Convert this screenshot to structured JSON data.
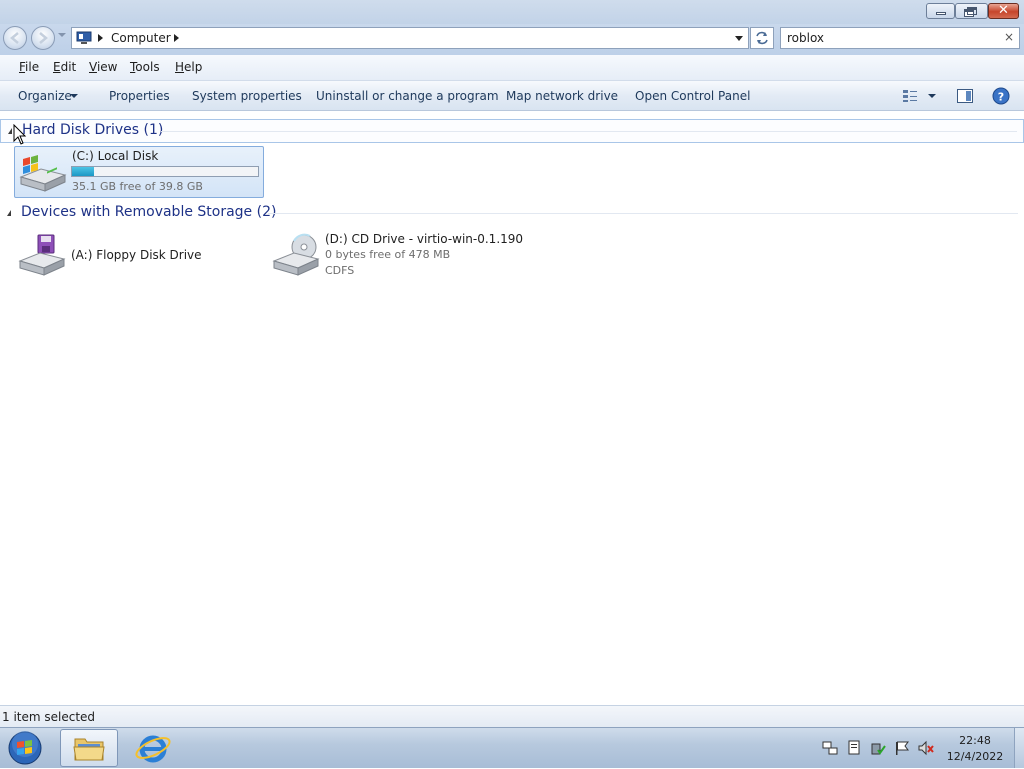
{
  "window": {
    "close_glyph": "✕"
  },
  "address_bar": {
    "crumb": "Computer"
  },
  "search": {
    "value": "roblox",
    "clear_glyph": "×"
  },
  "menu": {
    "items": [
      "File",
      "Edit",
      "View",
      "Tools",
      "Help"
    ]
  },
  "command_bar": {
    "organize": "Organize",
    "properties": "Properties",
    "system_properties": "System properties",
    "uninstall": "Uninstall or change a program",
    "map_drive": "Map network drive",
    "control_panel": "Open Control Panel"
  },
  "groups": {
    "hard_disk": {
      "title": "Hard Disk Drives (1)",
      "drives": [
        {
          "name": "(C:) Local Disk",
          "space": "35.1 GB free of 39.8 GB",
          "used_fraction": 0.12
        }
      ]
    },
    "removable": {
      "title": "Devices with Removable Storage (2)",
      "drives": [
        {
          "name": "(A:) Floppy Disk Drive"
        },
        {
          "name": "(D:) CD Drive - virtio-win-0.1.190",
          "space": "0 bytes free of 478 MB",
          "filesystem": "CDFS"
        }
      ]
    }
  },
  "status": {
    "text": "1 item selected"
  },
  "taskbar": {
    "time": "22:48",
    "date": "12/4/2022"
  },
  "colors": {
    "usage_bar": "#1c98c4",
    "group_title": "#1e3287",
    "selection_border": "#84acdd"
  }
}
